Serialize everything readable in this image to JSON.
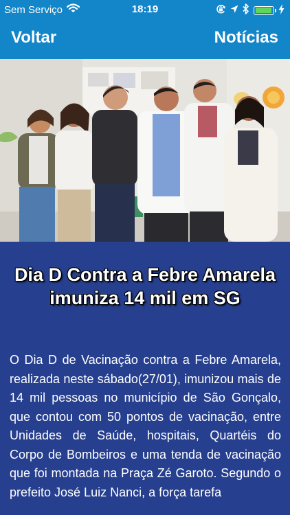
{
  "status_bar": {
    "carrier": "Sem Serviço",
    "time": "18:19",
    "battery_level": 0.95,
    "icons": [
      "wifi-icon",
      "orientation-lock-icon",
      "location-arrow-icon",
      "bluetooth-icon",
      "battery-icon",
      "charging-bolt-icon"
    ]
  },
  "nav": {
    "back_label": "Voltar",
    "title": "Notícias"
  },
  "article": {
    "photo": "group-photo",
    "headline": "Dia D Contra a Febre Amarela imuniza 14 mil em SG",
    "body": "O Dia D de Vacinação contra a Febre Amarela, realizada neste sábado(27/01), imunizou mais de 14 mil pessoas no município de São Gonçalo, que contou com 50 pontos de vacinação, entre Unidades de Saúde, hospitais, Quartéis do Corpo de Bombeiros e uma tenda de vacinação que foi montada na Praça Zé Garoto. Segundo o prefeito José Luiz Nanci, a força tarefa"
  },
  "colors": {
    "header": "#1385c9",
    "background": "#263f8e",
    "text": "#ffffff"
  }
}
